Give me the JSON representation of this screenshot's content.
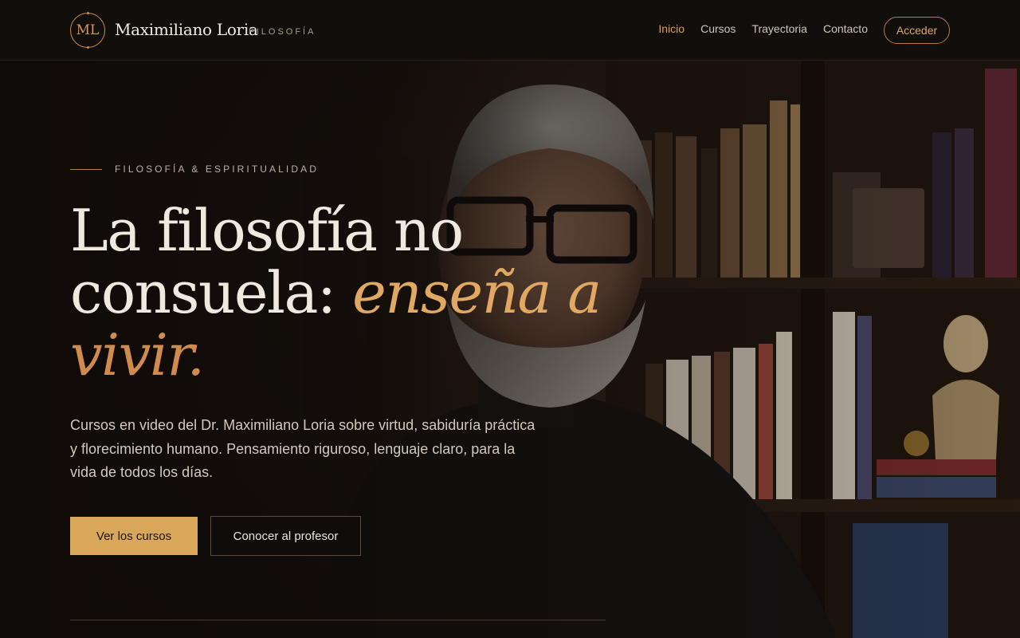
{
  "brand": {
    "monogram": "ML",
    "name": "Maximiliano Loria",
    "tagline": "FILOSOFÍA"
  },
  "nav": {
    "links": [
      {
        "label": "Inicio",
        "active": true
      },
      {
        "label": "Cursos",
        "active": false
      },
      {
        "label": "Trayectoria",
        "active": false
      },
      {
        "label": "Contacto",
        "active": false
      }
    ],
    "login_label": "Acceder"
  },
  "hero": {
    "eyebrow": "FILOSOFÍA & ESPIRITUALIDAD",
    "headline_part1": "La filosofía no consuela: ",
    "headline_accent": "enseña a",
    "headline_accent2": "vivir.",
    "lead": "Cursos en video del Dr. Maximiliano Loria sobre virtud, sabiduría práctica y florecimiento humano. Pensamiento riguroso, lenguaje claro, para la vida de todos los días.",
    "primary_cta": "Ver los cursos",
    "secondary_cta": "Conocer al profesor"
  },
  "colors": {
    "background": "#0f0b09",
    "accent": "#e0a862",
    "accent_deep": "#d08b4e",
    "primary_button": "#d9a75a"
  }
}
